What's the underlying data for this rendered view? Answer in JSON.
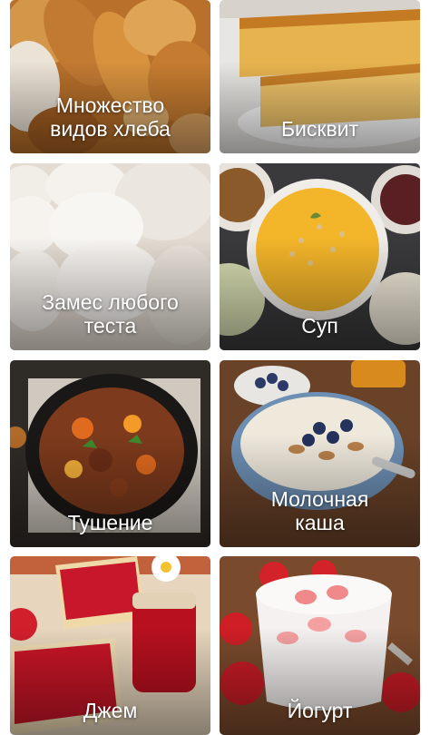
{
  "categories": [
    {
      "label": "Множество\nвидов хлеба",
      "icon": "bread-image"
    },
    {
      "label": "Бисквит",
      "icon": "sponge-cake-image"
    },
    {
      "label": "Замес любого\nтеста",
      "icon": "dough-image"
    },
    {
      "label": "Суп",
      "icon": "soup-image"
    },
    {
      "label": "Тушение",
      "icon": "stew-image"
    },
    {
      "label": "Молочная\nкаша",
      "icon": "porridge-image"
    },
    {
      "label": "Джем",
      "icon": "jam-image"
    },
    {
      "label": "Йогурт",
      "icon": "yogurt-image"
    }
  ]
}
